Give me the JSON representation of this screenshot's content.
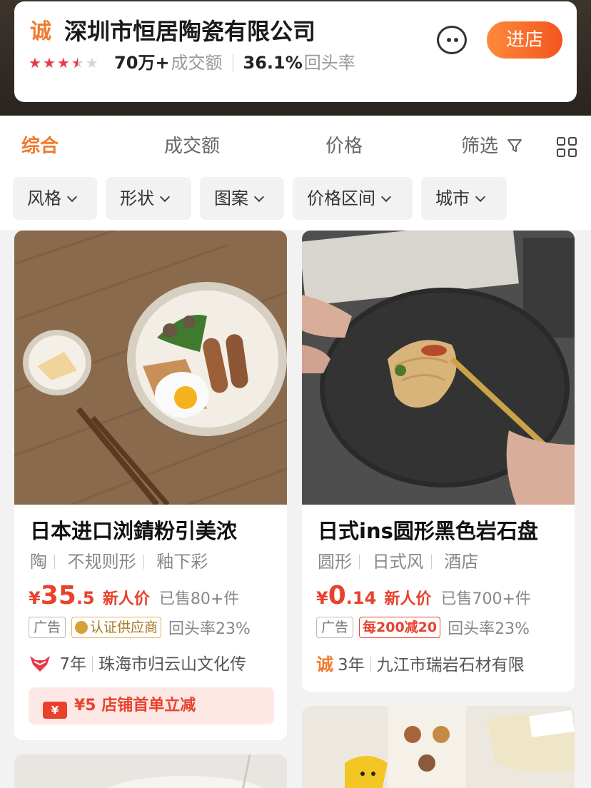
{
  "shop": {
    "cheng_badge": "诚",
    "name": "深圳市恒居陶瓷有限公司",
    "rating": 3.5,
    "stars": [
      "★",
      "★",
      "★",
      "★",
      "★"
    ],
    "sales_value": "70万+",
    "sales_label": "成交额",
    "repurchase_value": "36.1%",
    "repurchase_label": "回头率",
    "enter_label": "进店"
  },
  "sort": {
    "items": [
      {
        "label": "综合",
        "active": true
      },
      {
        "label": "成交额",
        "active": false
      },
      {
        "label": "价格",
        "active": false
      },
      {
        "label": "筛选",
        "active": false
      }
    ]
  },
  "filters": {
    "chips": [
      "风格",
      "形状",
      "图案",
      "价格区间",
      "城市"
    ]
  },
  "products": [
    {
      "title": "日本进口浏錆粉引美浓",
      "tags": [
        "陶",
        "不规则形",
        "釉下彩"
      ],
      "yen": "¥",
      "price_int": "35",
      "price_dec": ".5",
      "price_label": "新人价",
      "sold": "已售80+件",
      "ad": "广告",
      "badge": "认证供应商",
      "repurchase": "回头率23%",
      "years": "7年",
      "seller": "珠海市归云山文化传",
      "coupon": "¥5  店铺首单立减",
      "coupon_icon": "¥"
    },
    {
      "title": "日式ins圆形黑色岩石盘",
      "tags": [
        "圆形",
        "日式风",
        "酒店"
      ],
      "yen": "¥",
      "price_int": "0",
      "price_dec": ".14",
      "price_label": "新人价",
      "sold": "已售700+件",
      "ad": "广告",
      "badge": "每200减20",
      "repurchase": "回头率23%",
      "cheng": "诚",
      "years": "3年",
      "seller": "九江市瑞岩石材有限"
    }
  ],
  "colors": {
    "accent": "#f07a2e",
    "price": "#e8422c",
    "star": "#e8384a"
  }
}
